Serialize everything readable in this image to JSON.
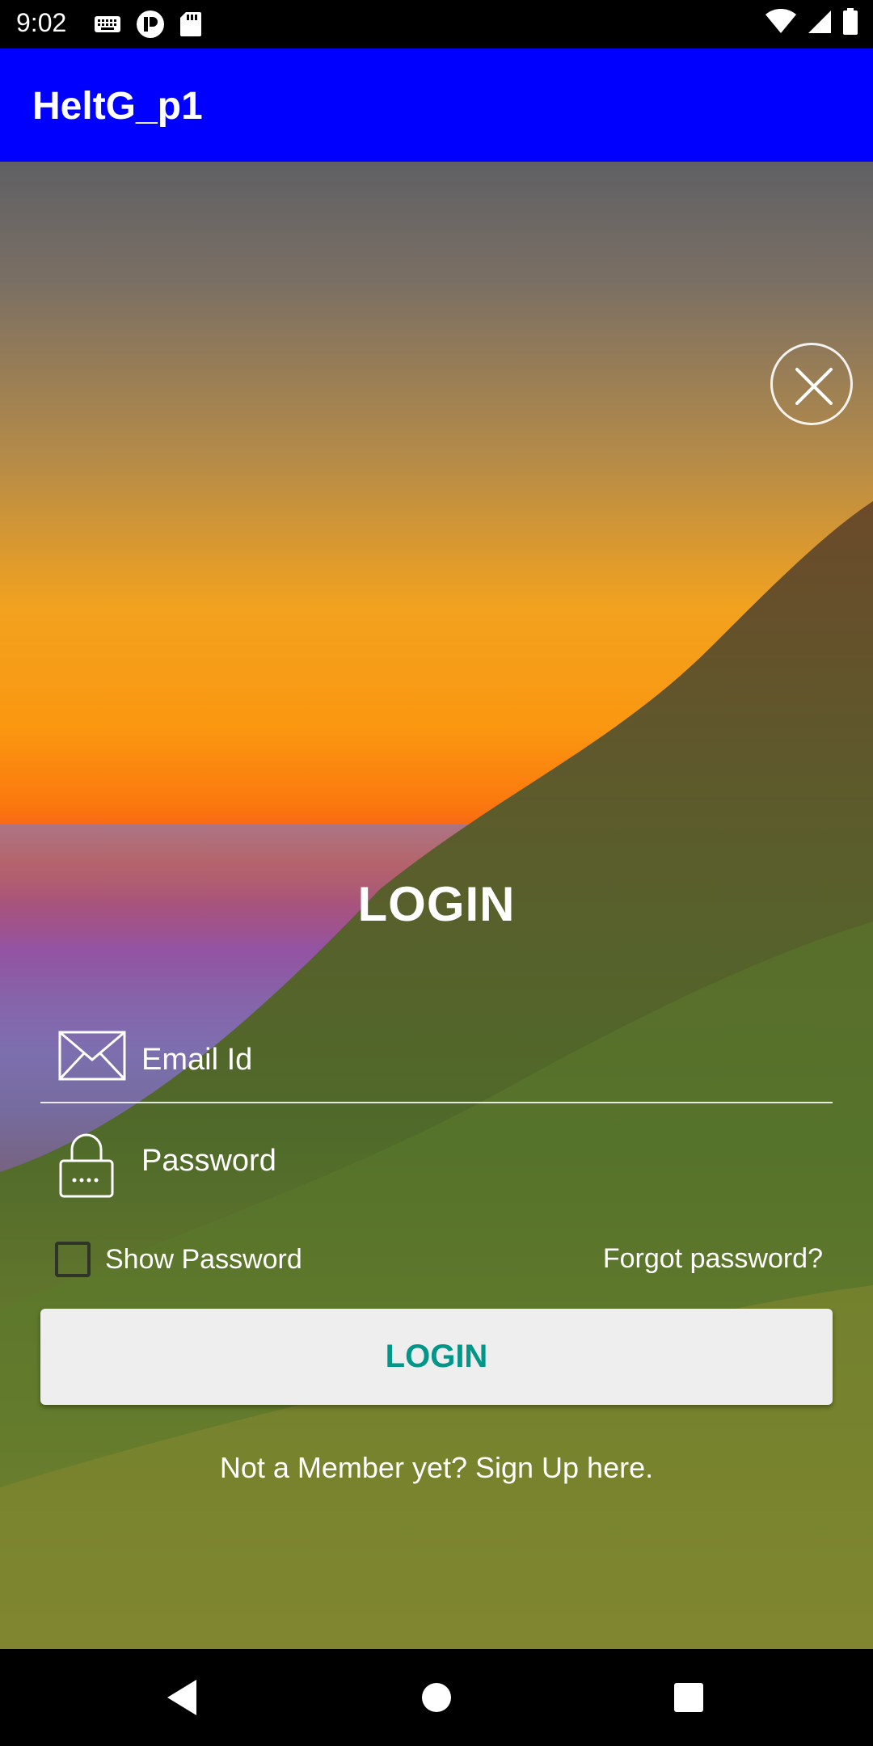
{
  "status_bar": {
    "time": "9:02",
    "left_icons": [
      "keyboard-icon",
      "app-notification-icon",
      "sd-card-icon"
    ],
    "right_icons": [
      "wifi-icon",
      "signal-icon",
      "battery-icon"
    ]
  },
  "app_bar": {
    "title": "HeltG_p1",
    "color": "#0000ff"
  },
  "login": {
    "title": "LOGIN",
    "email_placeholder": "Email Id",
    "password_placeholder": "Password",
    "show_password_label": "Show Password",
    "show_password_checked": false,
    "forgot_password": "Forgot password?",
    "login_button": "LOGIN",
    "login_button_color": "#009688",
    "signup_text": "Not a Member yet? Sign Up here."
  },
  "icons": {
    "close": "close-icon",
    "email": "mail-icon",
    "password": "lock-icon"
  },
  "nav_bar": {
    "buttons": [
      "back-icon",
      "home-icon",
      "recents-icon"
    ]
  }
}
